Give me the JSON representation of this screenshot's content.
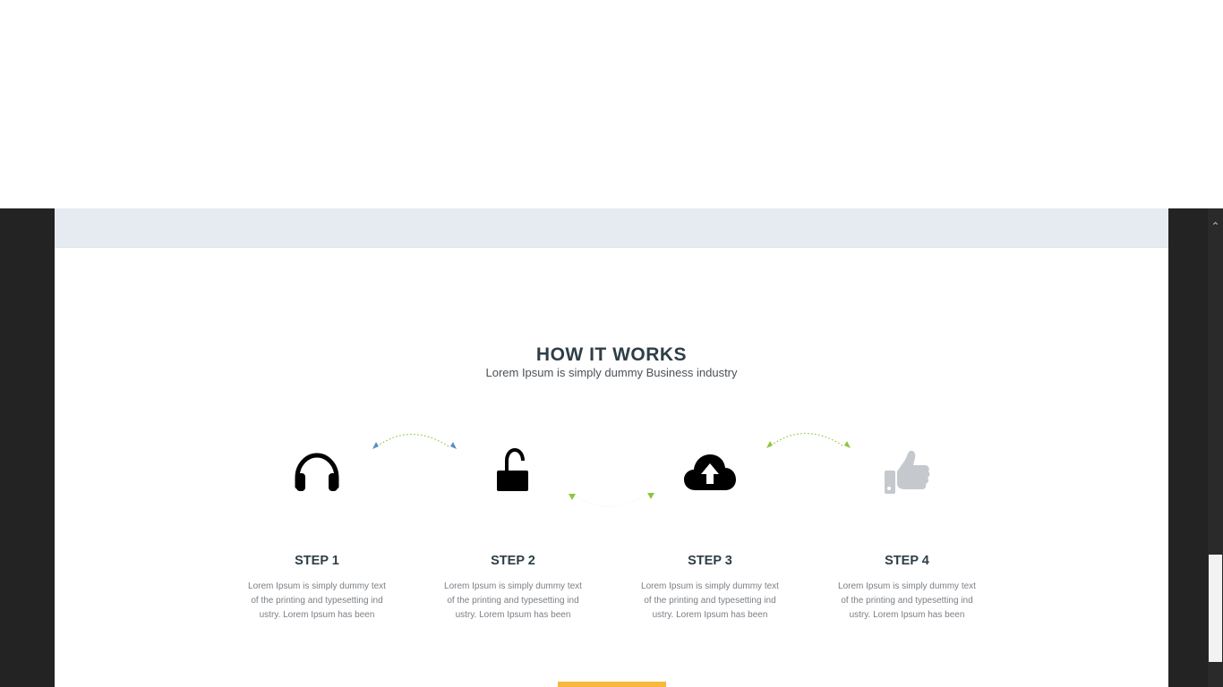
{
  "section": {
    "title": "HOW IT WORKS",
    "subtitle": "Lorem Ipsum is simply dummy Business industry"
  },
  "steps": [
    {
      "title": "STEP 1",
      "line1": "Lorem Ipsum is simply dummy text",
      "line2": "of the printing and typesetting ind",
      "line3": "ustry. Lorem Ipsum has been",
      "icon": "headphones-icon"
    },
    {
      "title": "STEP 2",
      "line1": "Lorem Ipsum is simply dummy text",
      "line2": "of the printing and typesetting ind",
      "line3": "ustry. Lorem Ipsum has been",
      "icon": "unlock-icon"
    },
    {
      "title": "STEP 3",
      "line1": "Lorem Ipsum is simply dummy text",
      "line2": "of the printing and typesetting ind",
      "line3": "ustry. Lorem Ipsum has been",
      "icon": "cloud-upload-icon"
    },
    {
      "title": "STEP 4",
      "line1": "Lorem Ipsum is simply dummy text",
      "line2": "of the printing and typesetting ind",
      "line3": "ustry. Lorem Ipsum has been",
      "icon": "thumbs-up-icon"
    }
  ],
  "colors": {
    "title": "#2e3e47",
    "body_text": "#7a7f85",
    "band": "#e6ebf2",
    "cta": "#f6b93b",
    "arrow_blue": "#5b8ec4",
    "arrow_green": "#8cc63f",
    "icon_dark": "#000000",
    "icon_muted": "#c5c9ce",
    "backdrop": "#232323"
  }
}
